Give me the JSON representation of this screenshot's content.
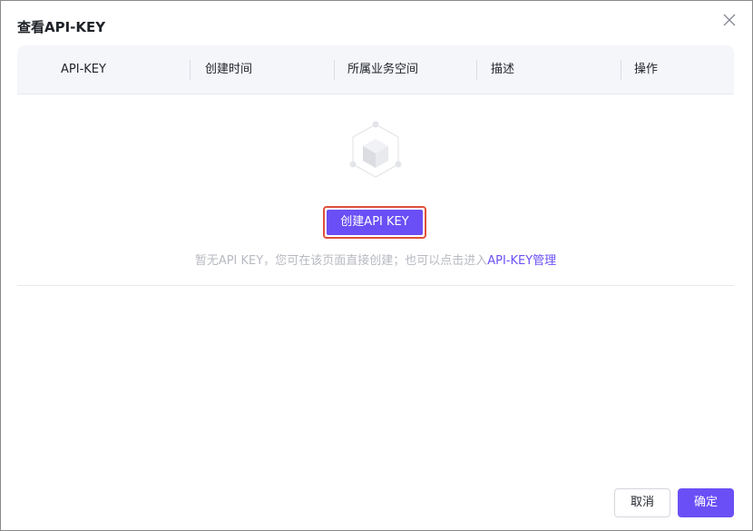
{
  "dialog": {
    "title": "查看API-KEY",
    "close_icon": "close-icon"
  },
  "table": {
    "columns": [
      "API-KEY",
      "创建时间",
      "所属业务空间",
      "描述",
      "操作"
    ]
  },
  "empty_state": {
    "icon": "empty-box-icon",
    "create_button_label": "创建API KEY",
    "message_prefix": "暂无API KEY，您可在该页面直接创建；也可以点击进入",
    "message_link": "API-KEY管理"
  },
  "footer": {
    "cancel_label": "取消",
    "confirm_label": "确定"
  },
  "colors": {
    "accent": "#6b4ff6",
    "highlight_border": "#e0503a",
    "muted_text": "#b8bac2",
    "header_bg": "#f5f6fa"
  }
}
